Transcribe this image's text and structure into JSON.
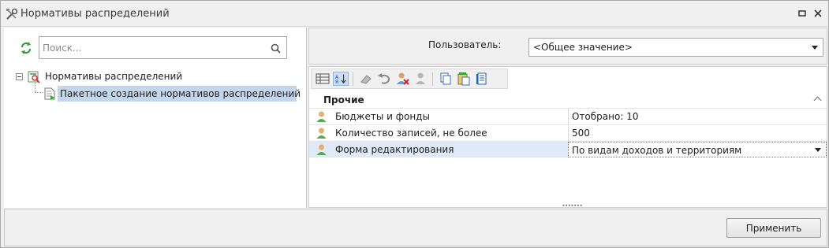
{
  "window": {
    "title": "Нормативы распределений"
  },
  "tree_panel": {
    "search_placeholder": "Поиск...",
    "root": {
      "label": "Нормативы распределений",
      "expanded": true
    },
    "child": {
      "label": "Пакетное создание нормативов распределений",
      "selected": true
    }
  },
  "user_bar": {
    "label": "Пользователь:",
    "value": "<Общее значение>"
  },
  "properties": {
    "category": "Прочие",
    "rows": [
      {
        "name": "Бюджеты и фонды",
        "value": "Отобрано: 10"
      },
      {
        "name": "Количество записей, не более",
        "value": "500"
      },
      {
        "name": "Форма редактирования",
        "value": "По видам доходов и территориям"
      }
    ]
  },
  "footer": {
    "apply_label": "Применить"
  },
  "colors": {
    "selection": "#c3d6ec",
    "row_selection": "#dfe9f7",
    "window_bg": "#f0f0f0"
  }
}
